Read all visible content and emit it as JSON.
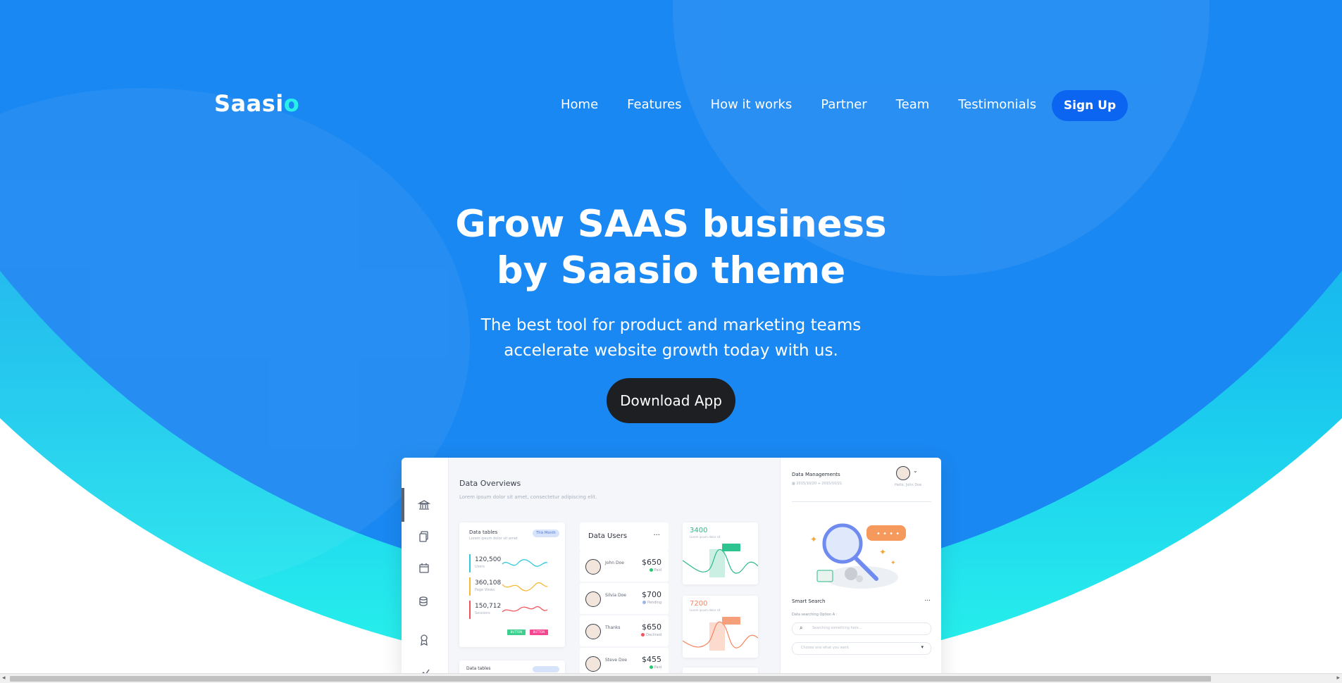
{
  "brand": {
    "name": "Saasi",
    "accent_letter": "o"
  },
  "nav": {
    "items": [
      "Home",
      "Features",
      "How it works",
      "Partner",
      "Team",
      "Testimonials"
    ],
    "signup": "Sign Up"
  },
  "hero": {
    "title_line1": "Grow SAAS business",
    "title_line2": "by Saasio theme",
    "subtitle_line1": "The best tool for product and marketing teams",
    "subtitle_line2": "accelerate website growth today with us.",
    "cta": "Download App"
  },
  "dashboard": {
    "heading": "Data Overviews",
    "subheading": "Lorem ipsum dolor sit amet, consectetur adipiscing elit.",
    "tables_card": {
      "title": "Data tables",
      "sub": "Lorem ipsum dolor sit amet",
      "filter": "This Month",
      "stats": [
        {
          "value": "120,500",
          "label": "Users",
          "color": "#33c9dc"
        },
        {
          "value": "360,108",
          "label": "Page Views",
          "color": "#f7b733"
        },
        {
          "value": "150,712",
          "label": "Sessions",
          "color": "#f2545b"
        }
      ],
      "btn_green": "BUTTON",
      "btn_pink": "BUTTON"
    },
    "tables_card2_title": "Data tables",
    "users_card": {
      "title": "Data Users",
      "more": "...",
      "users": [
        {
          "name": "John Doe",
          "price": "$650",
          "status": "Paid",
          "status_color": "#29c76f"
        },
        {
          "name": "Silvia Doe",
          "price": "$700",
          "status": "Pending",
          "status_color": "#9fb7e6"
        },
        {
          "name": "Thanks",
          "price": "$650",
          "status": "Declined",
          "status_color": "#f2545b"
        },
        {
          "name": "Steve Doe",
          "price": "$455",
          "status": "Paid",
          "status_color": "#29c76f"
        }
      ]
    },
    "mini_charts": [
      {
        "value": "3400",
        "label": "Lorem ipsum dolor sit",
        "color": "#29b98a"
      },
      {
        "value": "7200",
        "label": "Lorem ipsum dolor sit",
        "color": "#f7845e"
      }
    ],
    "right_panel": {
      "title": "Data Managements",
      "date": "2015/10/20 + 2015/10/21",
      "hello": "Hello, John Doe",
      "search_title": "Smart Search",
      "search_more": "...",
      "option_label": "Data searching Option A :",
      "search_placeholder": "Searching something here...",
      "select_placeholder": "Choose one what you want"
    }
  },
  "colors": {
    "hero_blue": "#1a88f2",
    "signup_bg": "#0c65f0",
    "cta_bg": "#1e1f23",
    "logo_accent": "#28f0e8"
  }
}
